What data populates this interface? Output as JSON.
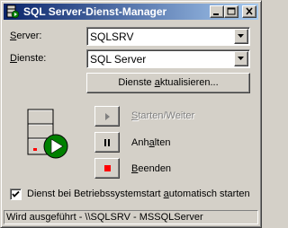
{
  "window": {
    "title": "SQL Server-Dienst-Manager"
  },
  "server": {
    "label_key": "S",
    "label_rest": "erver:",
    "value": "SQLSRV"
  },
  "services": {
    "label_key": "D",
    "label_rest": "ienste:",
    "value": "SQL Server"
  },
  "refresh": {
    "pre": "Dienste ",
    "key": "a",
    "post": "ktualisieren..."
  },
  "actions": {
    "start": {
      "pre": "",
      "key": "S",
      "post": "tarten/Weiter"
    },
    "pause": {
      "pre": "Anh",
      "key": "a",
      "post": "lten"
    },
    "stop": {
      "pre": "",
      "key": "B",
      "post": "eenden"
    }
  },
  "autostart": {
    "pre": "Dienst bei Betriebssystemstart ",
    "key": "a",
    "post": "utomatisch starten",
    "checked": true
  },
  "status": "Wird ausgeführt - \\\\SQLSRV - MSSQLServer",
  "colors": {
    "titlebar_start": "#0a246a",
    "titlebar_end": "#a6caf0",
    "running_green": "#008000",
    "stop_red": "#ff0000"
  },
  "icons": [
    "server-service-icon",
    "minimize-icon",
    "maximize-icon",
    "close-icon",
    "dropdown-arrow-icon",
    "play-icon",
    "pause-icon",
    "stop-icon",
    "checkmark-icon"
  ]
}
